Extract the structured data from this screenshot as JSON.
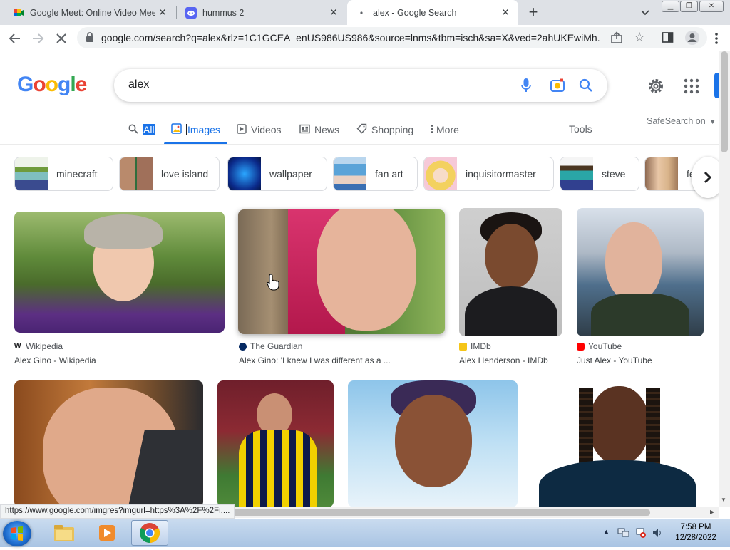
{
  "browser": {
    "tabs": [
      {
        "title": "Google Meet: Online Video Meet",
        "favicon": "google-meet-icon"
      },
      {
        "title": "hummus 2",
        "favicon": "discord-icon"
      },
      {
        "title": "alex - Google Search",
        "favicon": "loading-spinner-icon",
        "active": true
      }
    ],
    "url": "google.com/search?q=alex&rlz=1C1GCEA_enUS986US986&source=lnms&tbm=isch&sa=X&ved=2ahUKEwiMh..."
  },
  "google": {
    "query": "alex",
    "nav": [
      {
        "label": "All",
        "icon": "search-icon"
      },
      {
        "label": "Images",
        "icon": "image-icon",
        "active": true
      },
      {
        "label": "Videos",
        "icon": "play-icon"
      },
      {
        "label": "News",
        "icon": "newspaper-icon"
      },
      {
        "label": "Shopping",
        "icon": "tag-icon"
      },
      {
        "label": "More",
        "icon": "vertical-dots-icon"
      }
    ],
    "tools": "Tools",
    "safesearch": "SafeSearch on"
  },
  "chips": [
    "minecraft",
    "love island",
    "wallpaper",
    "fan art",
    "inquisitormaster",
    "steve",
    "fe"
  ],
  "results": [
    {
      "source": "Wikipedia",
      "title": "Alex Gino - Wikipedia"
    },
    {
      "source": "The Guardian",
      "title": "Alex Gino: 'I knew I was different as a ..."
    },
    {
      "source": "IMDb",
      "title": "Alex Henderson - IMDb"
    },
    {
      "source": "YouTube",
      "title": "Just Alex - YouTube"
    },
    {
      "source": "",
      "title": ""
    },
    {
      "source": "",
      "title": ""
    },
    {
      "source": "",
      "title": ""
    },
    {
      "source": "",
      "title": ""
    }
  ],
  "status_url": "https://www.google.com/imgres?imgurl=https%3A%2F%2Fi....",
  "taskbar": {
    "time": "7:58 PM",
    "date": "12/28/2022"
  },
  "colors": {
    "accent": "#1a73e8",
    "tab_strip": "#dee1e6"
  }
}
